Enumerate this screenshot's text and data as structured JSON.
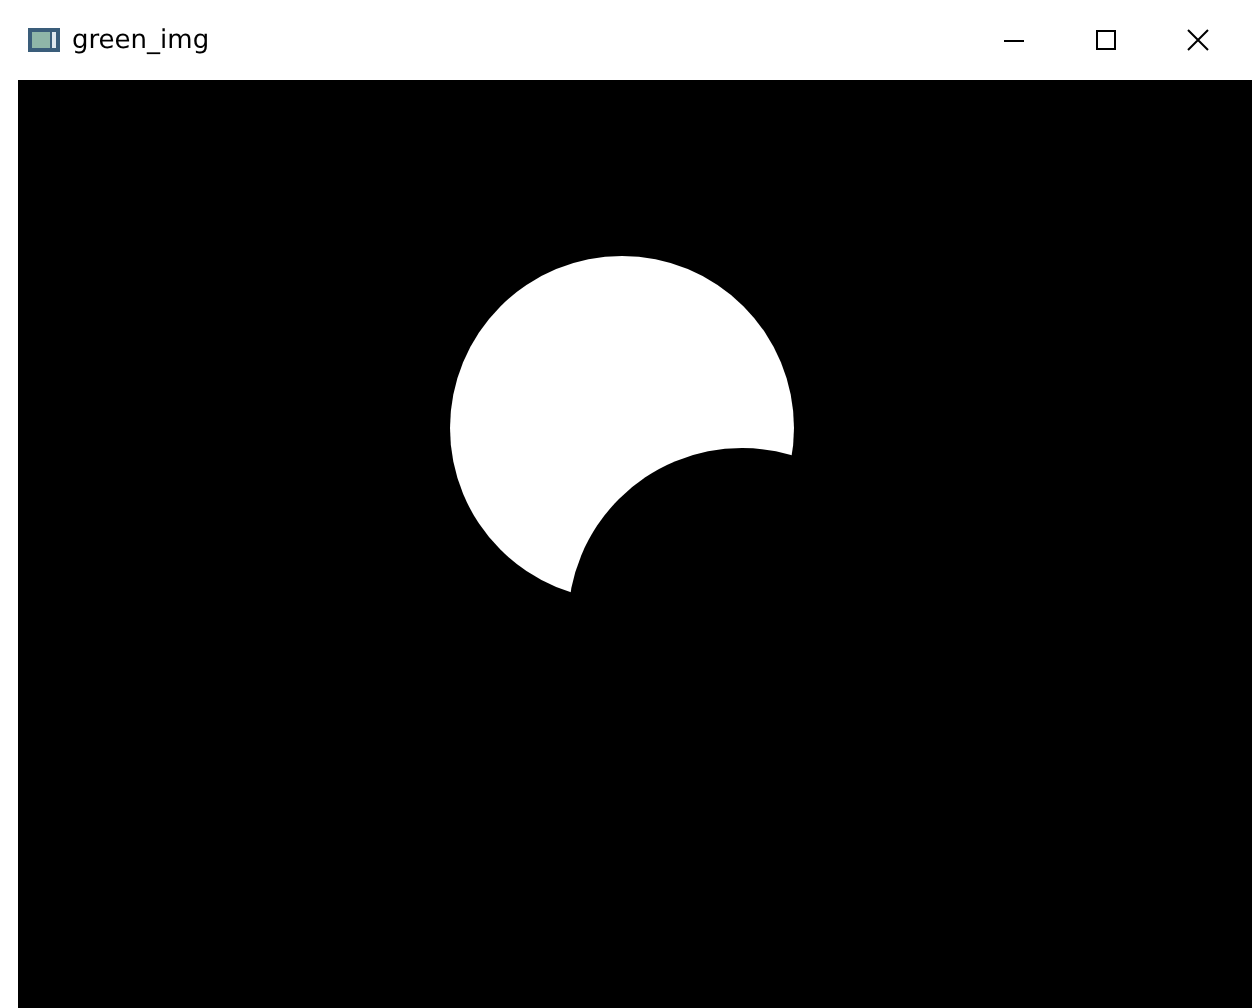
{
  "window": {
    "title": "green_img"
  }
}
